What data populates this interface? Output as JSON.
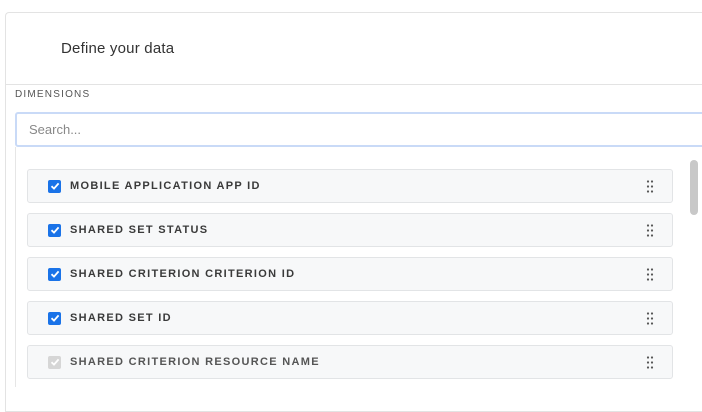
{
  "header": {
    "title": "Define your data"
  },
  "dimensions": {
    "label": "DIMENSIONS",
    "search_placeholder": "Search...",
    "items": [
      {
        "label": "MOBILE APPLICATION APP ID",
        "checked": true,
        "disabled": false
      },
      {
        "label": "SHARED SET STATUS",
        "checked": true,
        "disabled": false
      },
      {
        "label": "SHARED CRITERION CRITERION ID",
        "checked": true,
        "disabled": false
      },
      {
        "label": "SHARED SET ID",
        "checked": true,
        "disabled": false
      },
      {
        "label": "SHARED CRITERION RESOURCE NAME",
        "checked": true,
        "disabled": true
      }
    ]
  },
  "colors": {
    "accent": "#1a73e8",
    "disabled": "#d6d6d6"
  },
  "icons": {
    "checkbox": "check-icon",
    "drag": "drag-handle-icon"
  }
}
